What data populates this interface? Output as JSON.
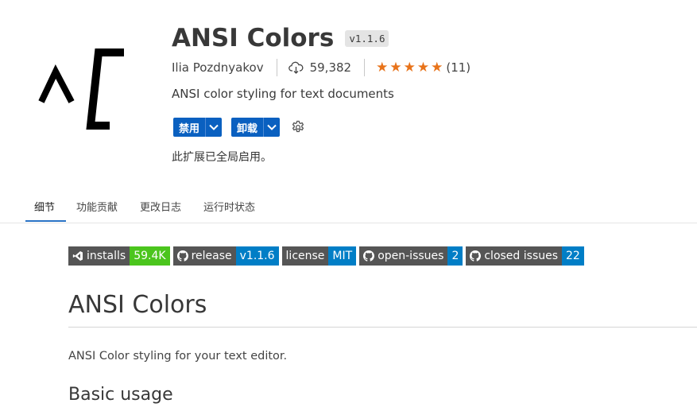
{
  "extension": {
    "logo_text": "^[",
    "title": "ANSI Colors",
    "version": "v1.1.6",
    "author": "Ilia Pozdnyakov",
    "installs": "59,382",
    "rating_stars": 5,
    "rating_count": "(11)",
    "description": "ANSI color styling for text documents",
    "status": "此扩展已全局启用。"
  },
  "actions": {
    "disable_label": "禁用",
    "uninstall_label": "卸载",
    "accent_color": "#0a60c0"
  },
  "tabs": [
    {
      "label": "细节",
      "active": true
    },
    {
      "label": "功能贡献",
      "active": false
    },
    {
      "label": "更改日志",
      "active": false
    },
    {
      "label": "运行时状态",
      "active": false
    }
  ],
  "badges": [
    {
      "icon": "vscode-icon",
      "label": "installs",
      "value": "59.4K",
      "color": "#4bc51d"
    },
    {
      "icon": "github-icon",
      "label": "release",
      "value": "v1.1.6",
      "color": "#007ec6"
    },
    {
      "icon": "",
      "label": "license",
      "value": "MIT",
      "color": "#007ec6"
    },
    {
      "icon": "github-icon",
      "label": "open-issues",
      "value": "2",
      "color": "#007ec6"
    },
    {
      "icon": "github-icon",
      "label": "closed issues",
      "value": "22",
      "color": "#007ec6"
    }
  ],
  "readme": {
    "title": "ANSI Colors",
    "intro": "ANSI Color styling for your text editor.",
    "section_heading": "Basic usage"
  }
}
